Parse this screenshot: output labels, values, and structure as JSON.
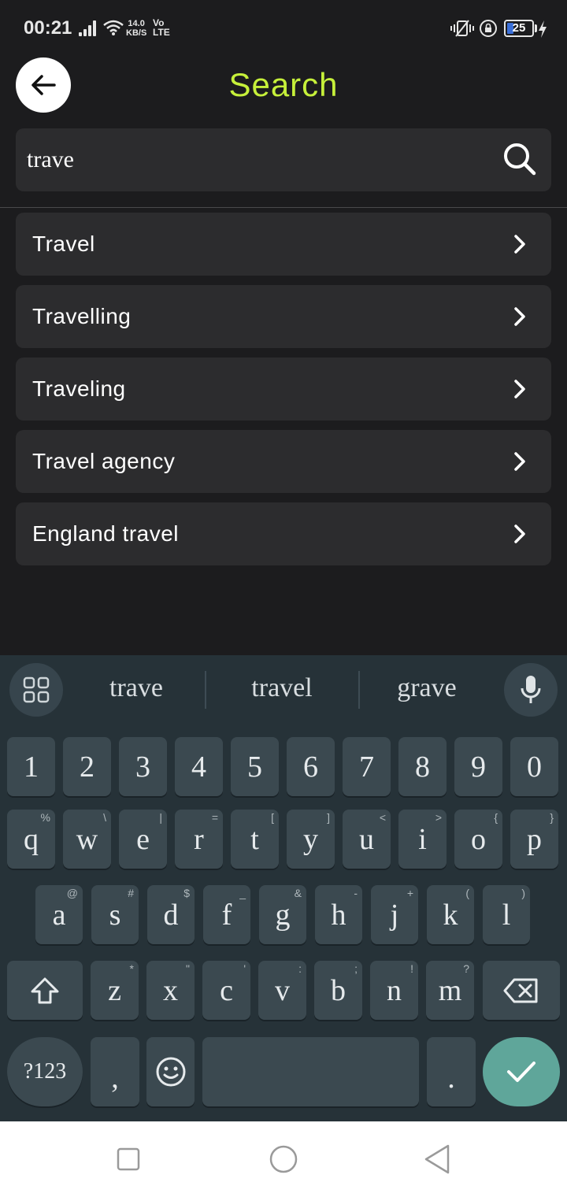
{
  "status_bar": {
    "time": "00:21",
    "net_speed_value": "14.0",
    "net_speed_unit": "KB/S",
    "network_vo": "Vo",
    "network_lte": "LTE",
    "battery_level": "25",
    "battery_fraction": 0.25,
    "icons": [
      "signal-icon",
      "wifi-icon",
      "vibrate-icon",
      "rotation-lock-icon",
      "battery-icon",
      "charging-icon"
    ]
  },
  "header": {
    "title": "Search",
    "back_icon": "arrow-left-icon",
    "title_color": "#c6f03a"
  },
  "search": {
    "value": "trave",
    "icon": "search-icon"
  },
  "suggestions": [
    {
      "label": "Travel"
    },
    {
      "label": "Travelling"
    },
    {
      "label": "Traveling"
    },
    {
      "label": "Travel agency"
    },
    {
      "label": "England travel"
    }
  ],
  "keyboard": {
    "suggestions": [
      "trave",
      "travel",
      "grave"
    ],
    "number_row": [
      "1",
      "2",
      "3",
      "4",
      "5",
      "6",
      "7",
      "8",
      "9",
      "0"
    ],
    "row1": [
      {
        "key": "q",
        "hint": "%"
      },
      {
        "key": "w",
        "hint": "\\"
      },
      {
        "key": "e",
        "hint": "|"
      },
      {
        "key": "r",
        "hint": "="
      },
      {
        "key": "t",
        "hint": "["
      },
      {
        "key": "y",
        "hint": "]"
      },
      {
        "key": "u",
        "hint": "<"
      },
      {
        "key": "i",
        "hint": ">"
      },
      {
        "key": "o",
        "hint": "{"
      },
      {
        "key": "p",
        "hint": "}"
      }
    ],
    "row2": [
      {
        "key": "a",
        "hint": "@"
      },
      {
        "key": "s",
        "hint": "#"
      },
      {
        "key": "d",
        "hint": "$"
      },
      {
        "key": "f",
        "hint": "_"
      },
      {
        "key": "g",
        "hint": "&"
      },
      {
        "key": "h",
        "hint": "-"
      },
      {
        "key": "j",
        "hint": "+"
      },
      {
        "key": "k",
        "hint": "("
      },
      {
        "key": "l",
        "hint": ")"
      }
    ],
    "row3": [
      {
        "key": "z",
        "hint": "*"
      },
      {
        "key": "x",
        "hint": "\""
      },
      {
        "key": "c",
        "hint": "'"
      },
      {
        "key": "v",
        "hint": ":"
      },
      {
        "key": "b",
        "hint": ";"
      },
      {
        "key": "n",
        "hint": "!"
      },
      {
        "key": "m",
        "hint": "?"
      }
    ],
    "symbols_label": "?123",
    "comma": ",",
    "period": ".",
    "accent_color": "#5fa69a"
  }
}
